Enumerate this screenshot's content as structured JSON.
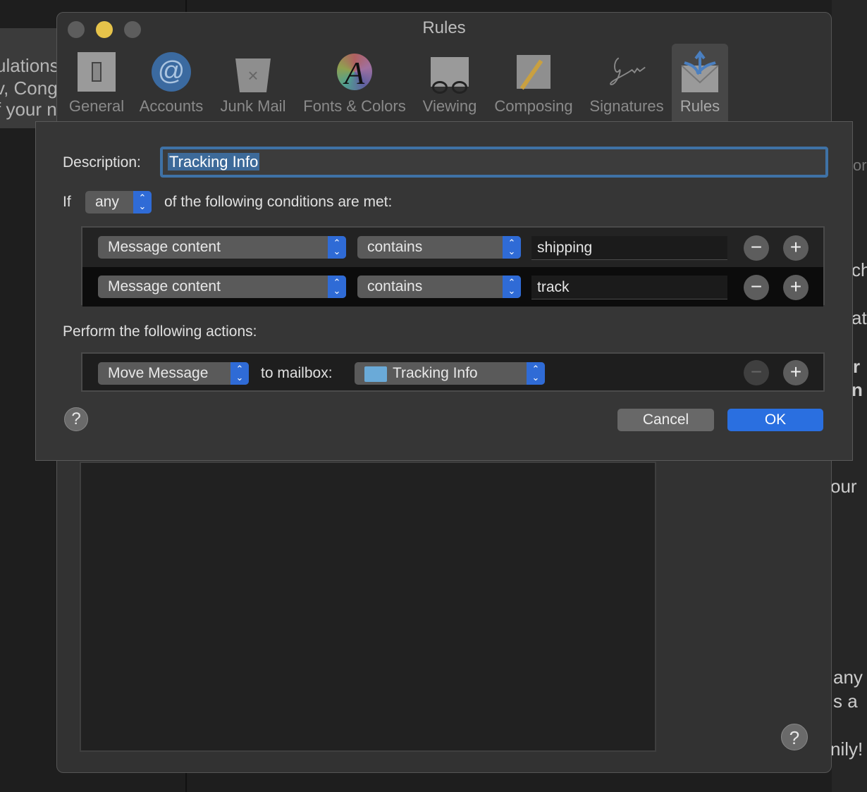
{
  "background": {
    "left_fragments": [
      "ulations",
      "v, Cong",
      "f your n"
    ],
    "right_fragments": [
      "or",
      "ch",
      "at",
      "r",
      "n",
      "our",
      "any",
      "s a",
      "nily!"
    ]
  },
  "window": {
    "title": "Rules",
    "toolbar": [
      {
        "label": "General",
        "icon": "switch-icon"
      },
      {
        "label": "Accounts",
        "icon": "at-icon"
      },
      {
        "label": "Junk Mail",
        "icon": "trash-icon"
      },
      {
        "label": "Fonts & Colors",
        "icon": "fonts-colors-icon"
      },
      {
        "label": "Viewing",
        "icon": "glasses-envelope-icon"
      },
      {
        "label": "Composing",
        "icon": "pencil-paper-icon"
      },
      {
        "label": "Signatures",
        "icon": "signature-icon"
      },
      {
        "label": "Rules",
        "icon": "rules-envelope-icon",
        "selected": true
      }
    ],
    "help": "?"
  },
  "sheet": {
    "description_label": "Description:",
    "description_value": "Tracking Info",
    "if_label": "If",
    "match_select": "any",
    "conditions_suffix": "of the following conditions are met:",
    "conditions": [
      {
        "field": "Message content",
        "operator": "contains",
        "value": "shipping"
      },
      {
        "field": "Message content",
        "operator": "contains",
        "value": "track"
      }
    ],
    "actions_label": "Perform the following actions:",
    "action": {
      "type": "Move Message",
      "to_label": "to mailbox:",
      "mailbox": "Tracking Info"
    },
    "remove_symbol": "−",
    "add_symbol": "+",
    "help": "?",
    "cancel": "Cancel",
    "ok": "OK"
  },
  "colors": {
    "accent": "#2f6bd6",
    "ok": "#2a6fe0",
    "focus": "#3f72a6"
  }
}
